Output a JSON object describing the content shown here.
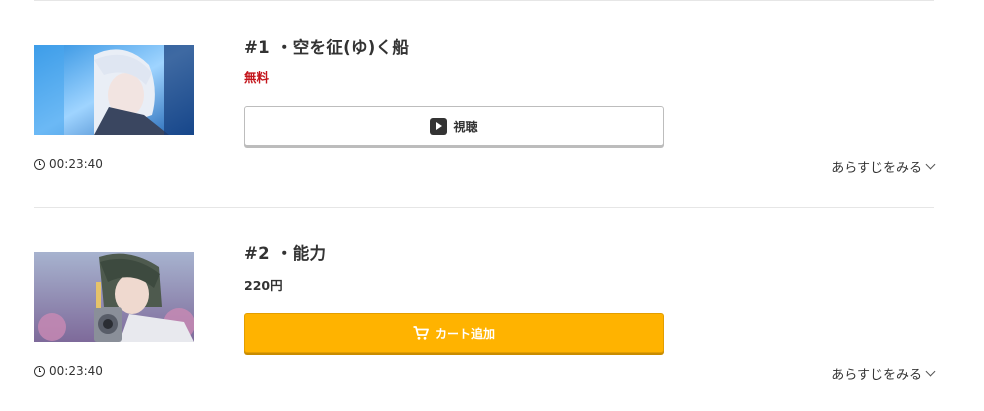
{
  "episodes": [
    {
      "title": "#1 ・空を征(ゆ)く船",
      "price": "無料",
      "button_label": "視聴",
      "duration": "00:23:40",
      "synopsis_label": "あらすじをみる"
    },
    {
      "title": "#2 ・能力",
      "price": "220円",
      "button_label": "カート追加",
      "duration": "00:23:40",
      "synopsis_label": "あらすじをみる"
    }
  ],
  "colors": {
    "free_price": "#c4161c",
    "cart_button": "#ffb300",
    "divider": "#e6e6e6"
  }
}
